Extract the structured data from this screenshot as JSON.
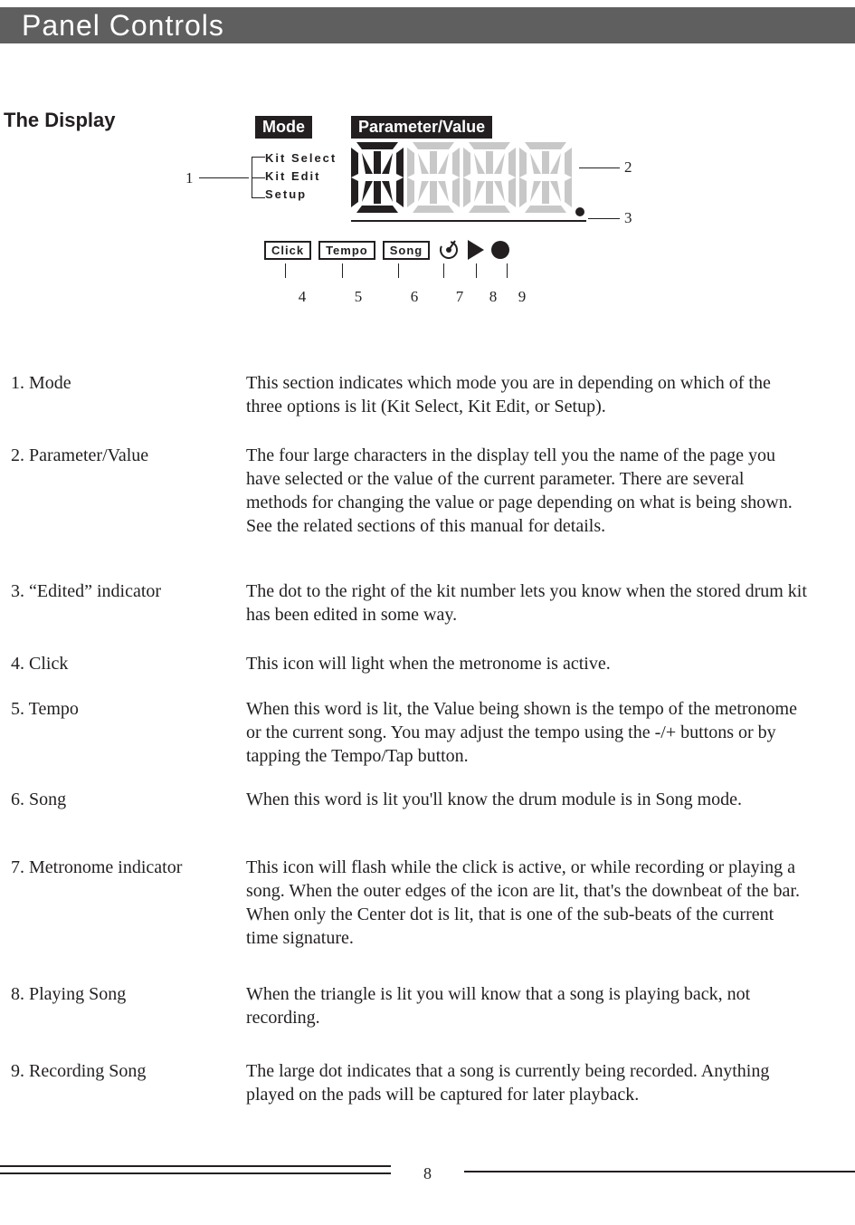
{
  "header": {
    "title": "Panel Controls"
  },
  "section": {
    "title": "The Display"
  },
  "diagram": {
    "badges": {
      "mode": "Mode",
      "param": "Parameter/Value"
    },
    "mode_labels": {
      "a": "Kit Select",
      "b": "Kit Edit",
      "c": "Setup"
    },
    "callouts": {
      "c1": "1",
      "c2": "2",
      "c3": "3"
    },
    "row2": {
      "click": "Click",
      "tempo": "Tempo",
      "song": "Song"
    },
    "row2_nums": {
      "n4": "4",
      "n5": "5",
      "n6": "6",
      "n7": "7",
      "n8": "8",
      "n9": "9"
    }
  },
  "items": {
    "i1": {
      "label": "1. Mode",
      "body": "This section indicates which mode you are in depending on which of the three options is lit (Kit Select, Kit Edit, or Setup)."
    },
    "i2": {
      "label": "2. Parameter/Value",
      "body": "The four large characters in the display tell you the name of the page you have selected or the value of the current parameter. There are several methods for changing the value or page depending on what is being shown. See the related sections of this manual for details."
    },
    "i3": {
      "label": "3. “Edited” indicator",
      "body": "The dot to the right of the kit number lets you know when the stored drum kit has been edited in some way."
    },
    "i4": {
      "label": "4. Click",
      "body": "This icon will light when the metronome is active."
    },
    "i5": {
      "label": "5. Tempo",
      "body": "When this word is lit, the Value being shown is the tempo of the metronome or the current song. You may adjust the tempo using the -/+ buttons or by tapping the Tempo/Tap button."
    },
    "i6": {
      "label": "6. Song",
      "body": "When this word is lit you'll know the drum module is in Song mode."
    },
    "i7": {
      "label": "7. Metronome indicator",
      "body": "This icon will flash while the click is active, or while recording or playing a song. When the outer edges of the icon are lit, that's the downbeat of the bar. When only the Center dot is lit, that is one of the sub-beats of the current time signature."
    },
    "i8": {
      "label": "8. Playing Song",
      "body": "When the triangle is lit you will know that a song is playing back, not recording."
    },
    "i9": {
      "label": "9. Recording Song",
      "body": "The large dot indicates that a song is currently being recorded. Anything played on the pads will be captured for later playback."
    }
  },
  "page_number": "8"
}
